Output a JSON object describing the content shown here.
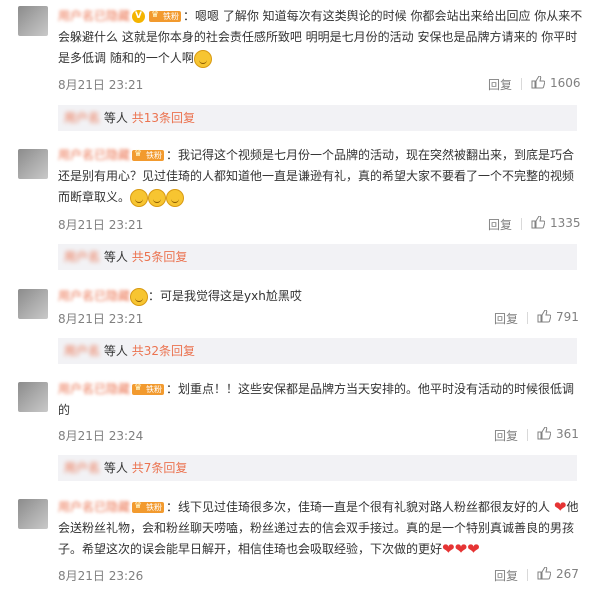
{
  "comments": [
    {
      "user": "用户名已隐藏",
      "badge": "铁粉",
      "text": "：嗯嗯 了解你 知道每次有这类舆论的时候 你都会站出来给出回应 你从来不会躲避什么 这就是你本身的社会责任感所致吧 明明是七月份的活动 安保也是品牌方请来的 你平时是多低调 随和的一个人啊",
      "time": "8月21日 23:21",
      "reply_label": "回复",
      "likes": "1606",
      "sub": {
        "name": "用户名",
        "label": "等人",
        "more": "共13条回复"
      }
    },
    {
      "user": "用户名已隐藏",
      "badge": "铁粉",
      "text": "：我记得这个视频是七月份一个品牌的活动，现在突然被翻出来，到底是巧合还是别有用心？见过佳琦的人都知道他一直是谦逊有礼，真的希望大家不要看了一个不完整的视频而断章取义。",
      "time": "8月21日 23:21",
      "reply_label": "回复",
      "likes": "1335",
      "sub": {
        "name": "用户名",
        "label": "等人",
        "more": "共5条回复"
      }
    },
    {
      "user": "用户名已隐藏",
      "badge": "",
      "text": "：可是我觉得这是yxh尬黑哎",
      "time": "8月21日 23:21",
      "reply_label": "回复",
      "likes": "791",
      "sub": {
        "name": "用户名",
        "label": "等人",
        "more": "共32条回复"
      }
    },
    {
      "user": "用户名已隐藏",
      "badge": "铁粉",
      "text": "：划重点！！这些安保都是品牌方当天安排的。他平时没有活动的时候很低调的",
      "time": "8月21日 23:24",
      "reply_label": "回复",
      "likes": "361",
      "sub": {
        "name": "用户名",
        "label": "等人",
        "more": "共7条回复"
      }
    },
    {
      "user": "用户名已隐藏",
      "badge": "铁粉",
      "text_a": "：线下见过佳琦很多次，佳琦一直是个很有礼貌对路人粉丝都很友好的人",
      "text_b": "他会送粉丝礼物，会和粉丝聊天唠嗑，粉丝递过去的信会双手接过。真的是一个特别真诚善良的男孩子。希望这次的误会能早日解开，相信佳琦也会吸取经验，下次做的更好",
      "time": "8月21日 23:26",
      "reply_label": "回复",
      "likes": "267"
    }
  ],
  "colors": {
    "link": "#eb7350",
    "meta": "#808080",
    "subbox": "#f2f2f5"
  },
  "icons": {
    "like": "thumbs-up-icon",
    "emoji": "smile-emoji-icon",
    "heart": "red-heart-icon",
    "vip": "verified-v-icon"
  }
}
